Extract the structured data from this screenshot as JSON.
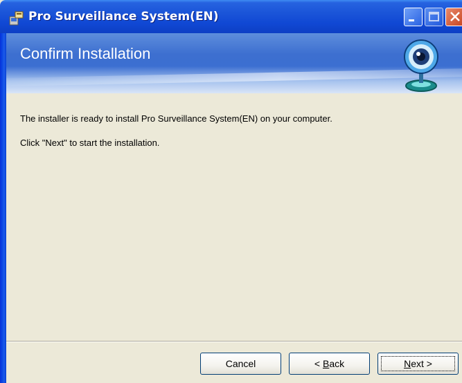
{
  "window": {
    "title": "Pro Surveillance System(EN)",
    "icons": {
      "app": "installer-icon",
      "minimize": "minimize-icon",
      "maximize": "maximize-icon",
      "close": "close-icon"
    }
  },
  "banner": {
    "title": "Confirm Installation",
    "icon": "webcam-icon"
  },
  "content": {
    "line1": "The installer is ready to install Pro Surveillance System(EN) on your computer.",
    "line2": "Click \"Next\" to start the installation."
  },
  "buttons": {
    "cancel": "Cancel",
    "back_mnemonic": "B",
    "back_rest": "ack",
    "back_prefix": "< ",
    "next_mnemonic": "N",
    "next_rest": "ext >"
  },
  "colors": {
    "titlebar": "#1A54D8",
    "background": "#ECE9D8",
    "close_button": "#C7411C"
  }
}
